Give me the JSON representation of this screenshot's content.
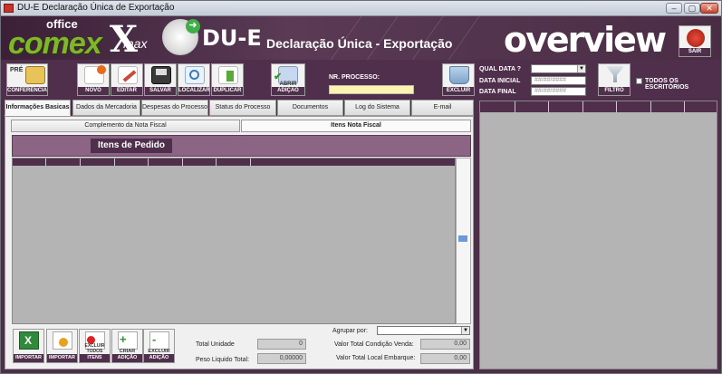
{
  "window": {
    "title": "DU-E  Declaração Única de Exportação"
  },
  "header": {
    "logo_office": "office",
    "logo_comex": "comex",
    "logo_x": "X",
    "logo_max": "max",
    "app_title": "DU-E",
    "app_subtitle": "Declaração Única - Exportação",
    "overview": "overview",
    "exit_label": "SAIR"
  },
  "toolbar": {
    "pre_label": "PRÉ",
    "conferencia": "CONFERENCIA",
    "novo": "NOVO",
    "editar": "EDITAR",
    "salvar": "SALVAR",
    "localizar": "LOCALIZAR",
    "duplicar": "DUPLICAR",
    "abrir": "ABRIR",
    "adicao": "ADIÇÃO",
    "nr_processo_label": "NR. PROCESSO:",
    "excluir": "EXCLUIR",
    "filtro": "FILTRO",
    "qual_data_label": "QUAL DATA ?",
    "data_inicial_label": "DATA INICIAL",
    "data_final_label": "DATA FINAL",
    "date_placeholder": "##/##/####",
    "todos_escritorios": "TODOS OS ESCRITÓRIOS"
  },
  "tabs": [
    {
      "label": "Informações Basicas"
    },
    {
      "label": "Dados da Mercadoria"
    },
    {
      "label": "Despesas do Processo"
    },
    {
      "label": "Status do Processo"
    },
    {
      "label": "Documentos"
    },
    {
      "label": "Log do Sistema"
    },
    {
      "label": "E-mail"
    }
  ],
  "subtabs": [
    {
      "label": "Complemento da Nota Fiscal"
    },
    {
      "label": "Itens Nota Fiscal"
    }
  ],
  "itens": {
    "title": "Itens de Pedido"
  },
  "bottom": {
    "importar": "IMPORTAR",
    "importar2": "IMPORTAR",
    "excluir_todos": "EXCLUIR TODOS",
    "itens": "ITENS",
    "criar": "CRIAR",
    "adicao1": "ADIÇÃO",
    "excluir": "EXCLUIR",
    "adicao2": "ADIÇÃO",
    "total_unidade_label": "Total Unidade",
    "total_unidade_value": "0",
    "peso_liquido_label": "Peso Liquido Total:",
    "peso_liquido_value": "0,00000",
    "agrupar_label": "Agrupar por:",
    "valor_condicao_label": "Valor Total Condição Venda:",
    "valor_condicao_value": "0,00",
    "valor_local_label": "Valor Total Local Embarque:",
    "valor_local_value": "0,00"
  },
  "colors": {
    "brand": "#4f2f4b",
    "accent": "#7fb62a",
    "bar": "#8c6585"
  }
}
